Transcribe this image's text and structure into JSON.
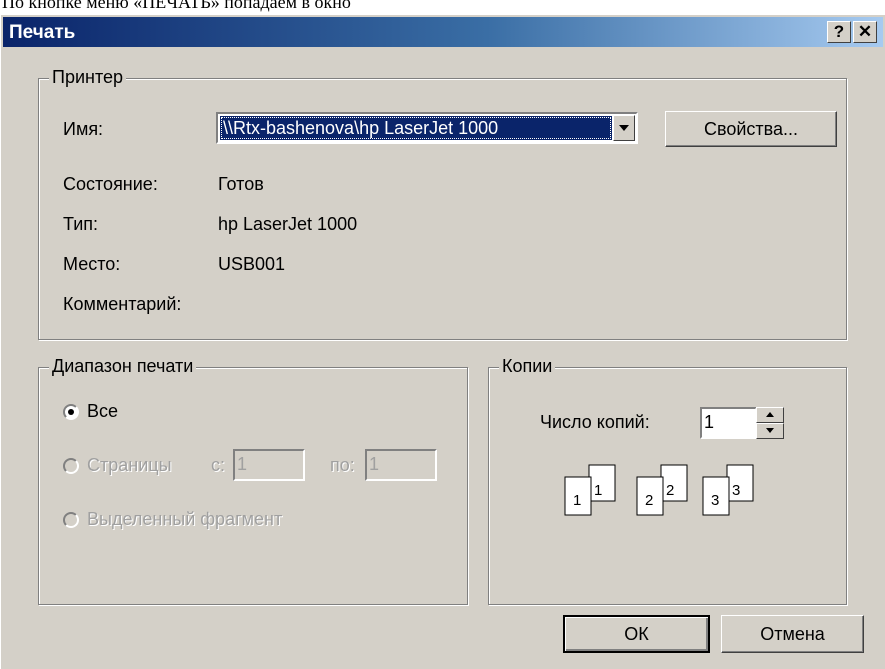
{
  "caption_text": "По кнопке меню «ПЕЧАТЬ» попадаем в окно",
  "dialog": {
    "title": "Печать",
    "help_button": "?",
    "close_button": "✕"
  },
  "printer": {
    "legend": "Принтер",
    "name_label": "Имя:",
    "name_value": "\\\\Rtx-bashenova\\hp LaserJet 1000",
    "properties_button": "Свойства...",
    "status_label": "Состояние:",
    "status_value": "Готов",
    "type_label": "Тип:",
    "type_value": "hp LaserJet 1000",
    "where_label": "Место:",
    "where_value": "USB001",
    "comment_label": "Комментарий:"
  },
  "range": {
    "legend": "Диапазон печати",
    "all_label": "Все",
    "pages_label": "Страницы",
    "from_label": "с:",
    "from_value": "1",
    "to_label": "по:",
    "to_value": "1",
    "selection_label": "Выделенный фрагмент",
    "selected": "all"
  },
  "copies": {
    "legend": "Копии",
    "count_label": "Число копий:",
    "count_value": "1",
    "collate_pages": [
      "1",
      "1",
      "2",
      "2",
      "3",
      "3"
    ]
  },
  "footer": {
    "ok_button": "ОК",
    "cancel_button": "Отмена"
  },
  "colors": {
    "titlebar_start": "#0a246a",
    "titlebar_end": "#a6caf0",
    "face": "#d4d0c8",
    "selection": "#0a246a"
  }
}
